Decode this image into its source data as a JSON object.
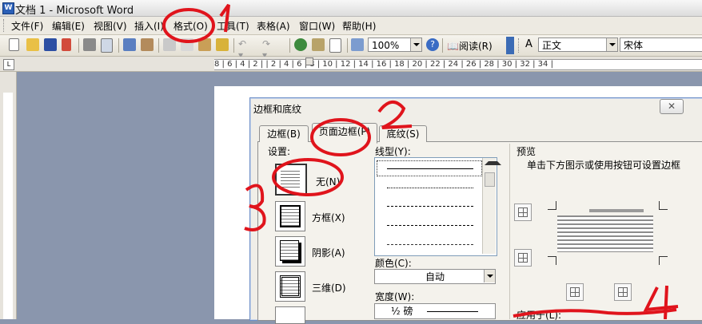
{
  "window": {
    "title": "文档 1 - Microsoft Word"
  },
  "menu": [
    "文件(F)",
    "编辑(E)",
    "视图(V)",
    "插入(I)",
    "格式(O)",
    "工具(T)",
    "表格(A)",
    "窗口(W)",
    "帮助(H)"
  ],
  "toolbar": {
    "zoom": "100%",
    "read_label": "阅读(R)",
    "style": "正文",
    "font": "宋体"
  },
  "ruler": {
    "text": "8 | 6 | 4 | 2 |   | 2 | 4 | 6 | 8 | 10 | 12 | 14 | 16 | 18 | 20 | 22 | 24 | 26 | 28 | 30 | 32 | 34 |",
    "tab_marker": "L"
  },
  "dialog": {
    "title": "边框和底纹",
    "close": "✕",
    "tabs": [
      "边框(B)",
      "页面边框(P)",
      "底纹(S)"
    ],
    "settings_label": "设置:",
    "settings": [
      "无(N)",
      "方框(X)",
      "阴影(A)",
      "三维(D)"
    ],
    "line_style_label": "线型(Y):",
    "color_label": "颜色(C):",
    "color_value": "自动",
    "width_label": "宽度(W):",
    "width_value": "½ 磅",
    "preview_label": "预览",
    "preview_hint": "单击下方图示或使用按钮可设置边框",
    "apply_to_label": "应用于(L):"
  },
  "annotations": [
    "1",
    "2",
    "3",
    "4"
  ],
  "colors": {
    "annotation": "#e0141c",
    "dialog_border": "#6d8fc8",
    "desktop": "#8a96ad"
  }
}
